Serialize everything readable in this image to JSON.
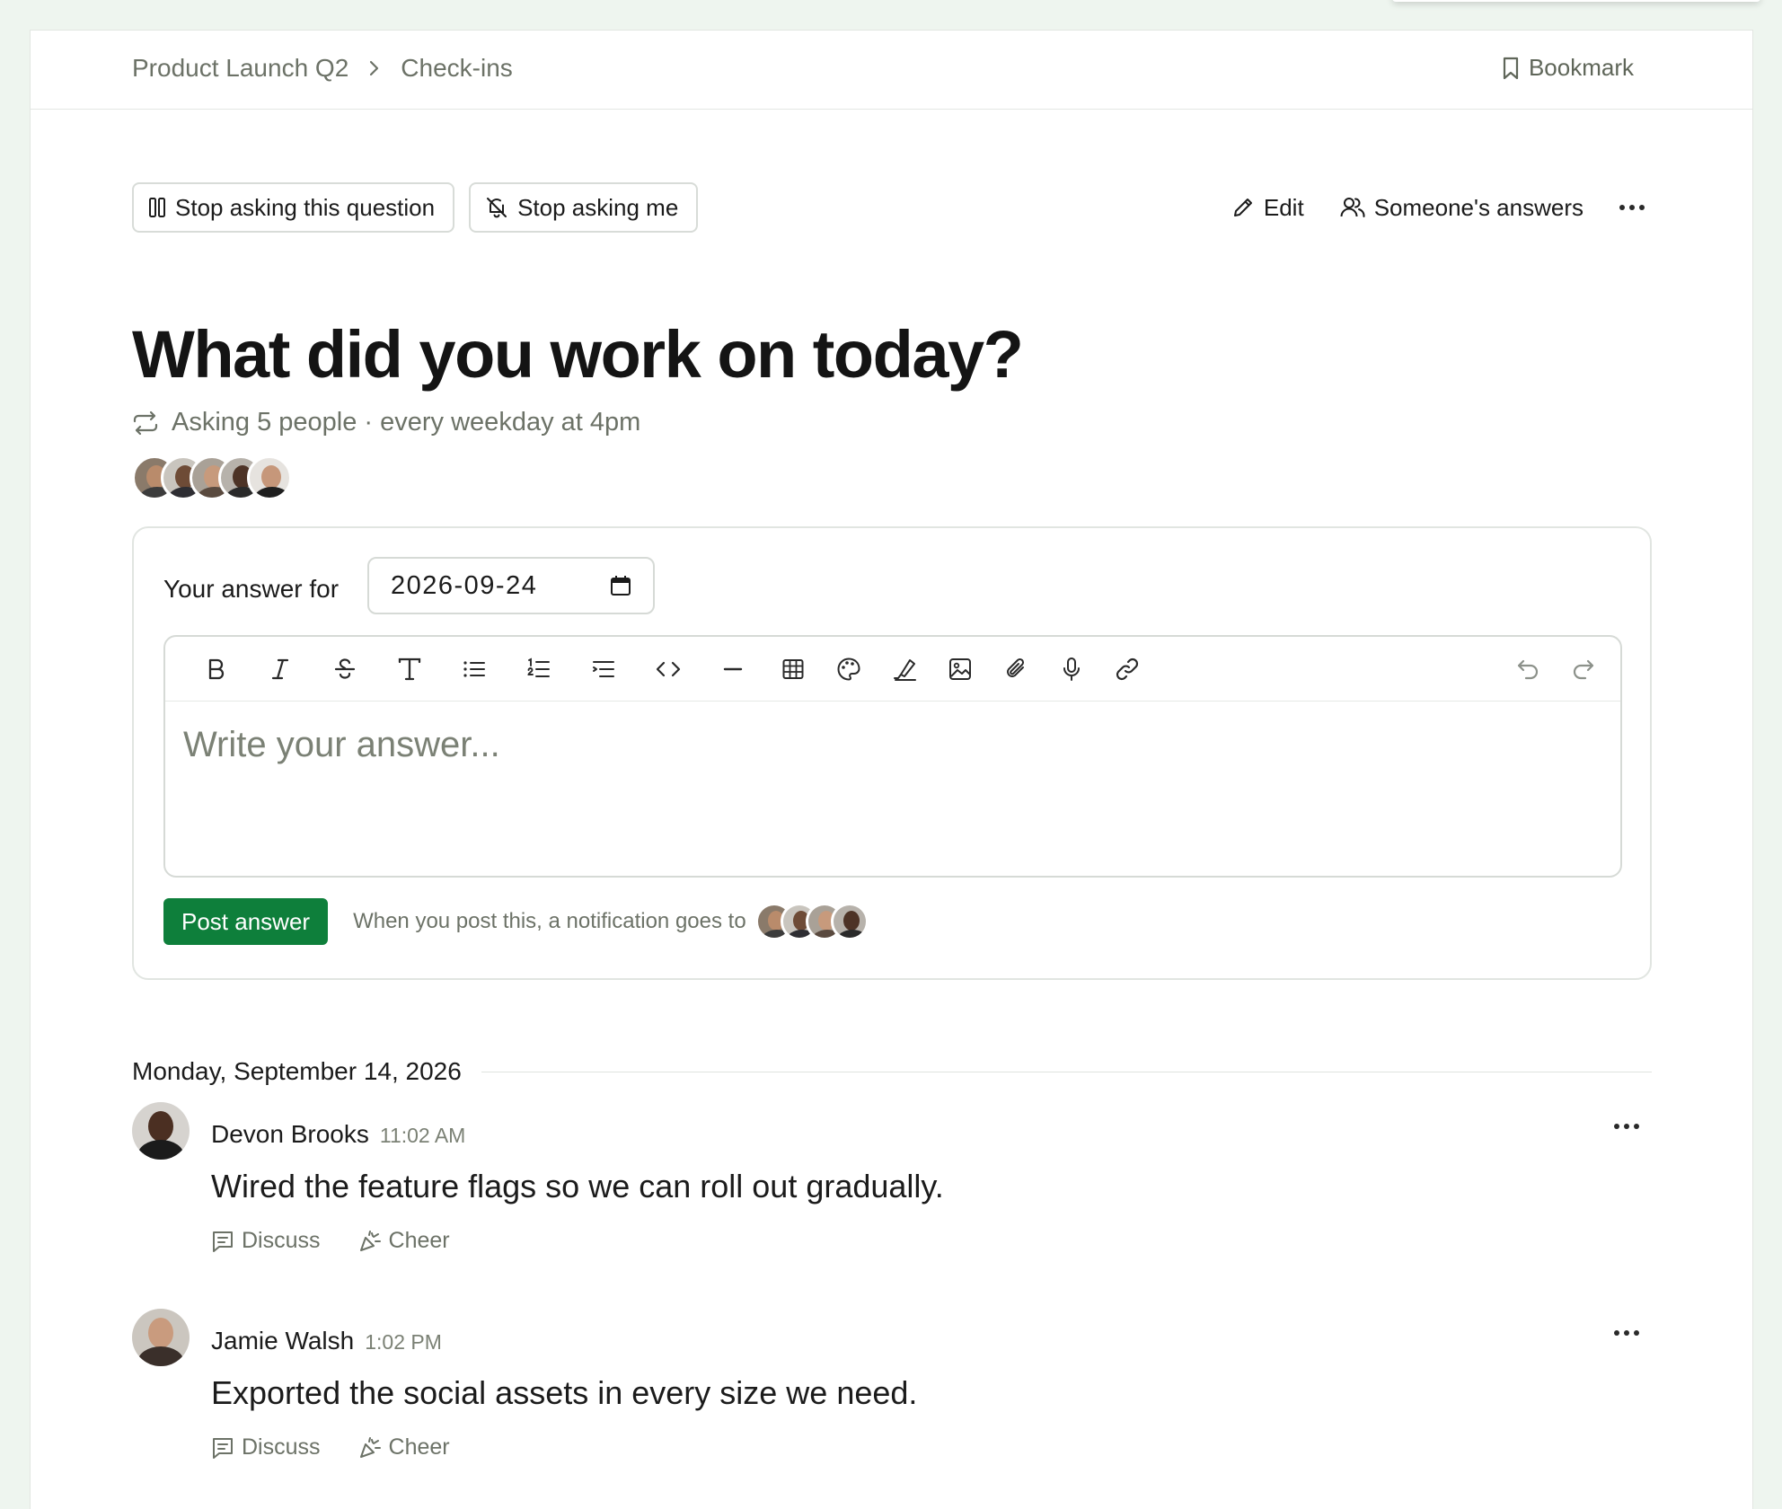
{
  "breadcrumb": {
    "project": "Product Launch Q2",
    "section": "Check-ins"
  },
  "header": {
    "bookmark_label": "Bookmark"
  },
  "actions": {
    "stop_question": "Stop asking this question",
    "stop_me": "Stop asking me",
    "edit": "Edit",
    "someones_answers": "Someone's answers"
  },
  "question": {
    "title": "What did you work on today?",
    "schedule": "Asking 5 people · every weekday at 4pm"
  },
  "answer": {
    "label": "Your answer for",
    "date": "2026-09-24",
    "placeholder": "Write your answer...",
    "post_label": "Post answer",
    "notify_text": "When you post this, a notification goes to"
  },
  "feed": {
    "date_heading": "Monday, September 14, 2026",
    "entries": [
      {
        "name": "Devon Brooks",
        "time": "11:02 AM",
        "text": "Wired the feature flags so we can roll out gradually.",
        "discuss": "Discuss",
        "cheer": "Cheer"
      },
      {
        "name": "Jamie Walsh",
        "time": "1:02 PM",
        "text": "Exported the social assets in every size we need.",
        "discuss": "Discuss",
        "cheer": "Cheer"
      }
    ]
  },
  "colors": {
    "accent": "#0e7f3b",
    "muted": "#6c7267",
    "background": "#eef5ef"
  }
}
